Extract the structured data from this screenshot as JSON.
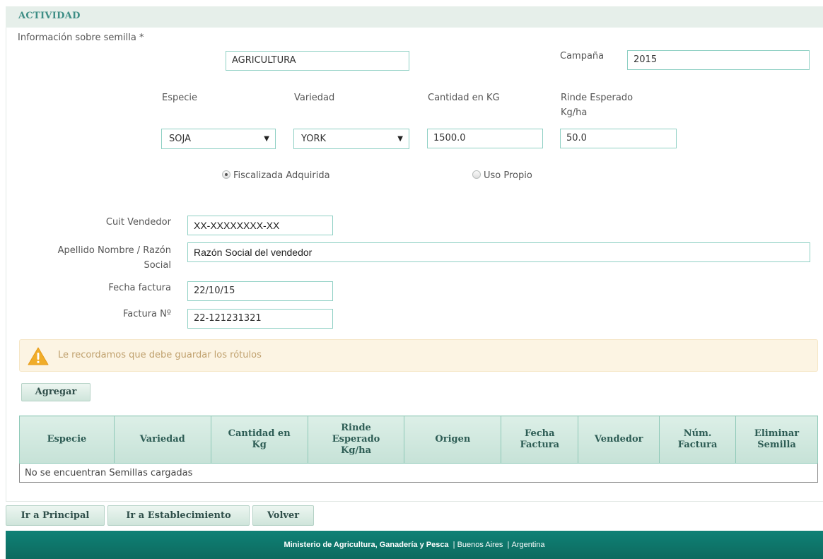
{
  "section": {
    "title": "ACTIVIDAD"
  },
  "seed": {
    "info_label": "Información sobre semilla *",
    "activity_value": "AGRICULTURA",
    "campaign_label": "Campaña",
    "campaign_value": "2015"
  },
  "columns": {
    "especie": "Especie",
    "variedad": "Variedad",
    "cantidad": "Cantidad en KG",
    "rinde_line1": "Rinde Esperado",
    "rinde_line2": "Kg/ha"
  },
  "fields": {
    "especie_value": "SOJA",
    "variedad_value": "YORK",
    "cantidad_value": "1500.0",
    "rinde_value": "50.0"
  },
  "origin": {
    "option1": "Fiscalizada Adquirida",
    "option2": "Uso Propio",
    "selected": "Fiscalizada Adquirida"
  },
  "seller": {
    "cuit_label": "Cuit Vendedor",
    "cuit_value": "XX-XXXXXXXX-XX",
    "name_label_line1": "Apellido Nombre / Razón",
    "name_label_line2": "Social",
    "name_value": "Razón Social del vendedor",
    "invoice_date_label": "Fecha factura",
    "invoice_date_value": "22/10/15",
    "invoice_number_label": "Factura Nº",
    "invoice_number_value": "22-121231321"
  },
  "alert": {
    "text": "Le recordamos que debe guardar los rótulos"
  },
  "buttons": {
    "add": "Agregar",
    "main": "Ir a Principal",
    "establishment": "Ir a Establecimiento",
    "back": "Volver"
  },
  "table": {
    "headers": [
      [
        "Especie"
      ],
      [
        "Variedad"
      ],
      [
        "Cantidad en",
        "Kg"
      ],
      [
        "Rinde",
        "Esperado",
        "Kg/ha"
      ],
      [
        "Origen"
      ],
      [
        "Fecha",
        "Factura"
      ],
      [
        "Vendedor"
      ],
      [
        "Núm.",
        "Factura"
      ],
      [
        "Eliminar",
        "Semilla"
      ]
    ],
    "empty_text": "No se encuentran Semillas cargadas"
  },
  "footer": {
    "ministry": "Ministerio de Agricultura, Ganadería y Pesca",
    "province": "Buenos Aires",
    "country": "Argentina"
  },
  "colors": {
    "accent": "#3e8e86",
    "input_border": "#8fd0c4",
    "footer_bg": "#0d6a5f",
    "alert_bg": "#fcf4e3",
    "alert_text": "#c0a16e",
    "warning_icon": "#f0ad2a"
  }
}
